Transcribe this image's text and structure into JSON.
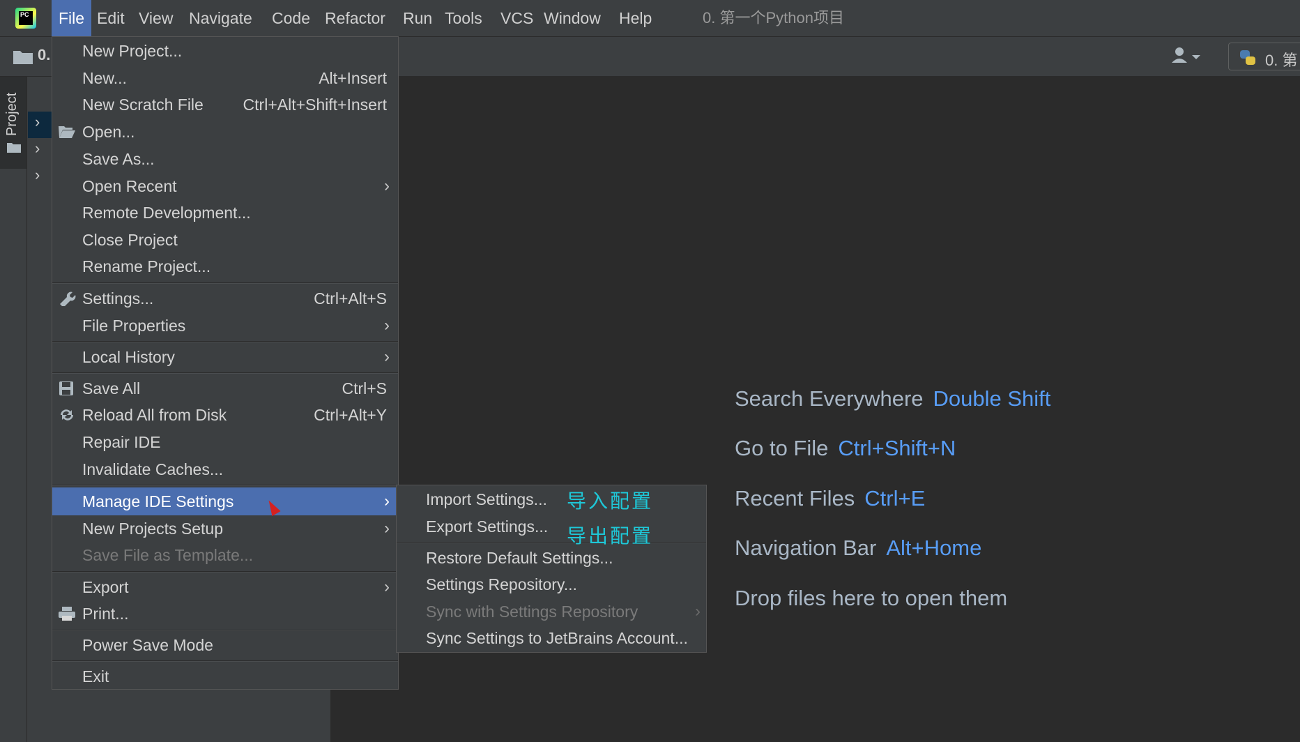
{
  "menubar": {
    "items": [
      "File",
      "Edit",
      "View",
      "Navigate",
      "Code",
      "Refactor",
      "Run",
      "Tools",
      "VCS",
      "Window",
      "Help"
    ],
    "active": "File",
    "window_title": "0. 第一个Python项目"
  },
  "toolbar": {
    "project_crumb": "0.",
    "run_config_label": "0. 第"
  },
  "sidebar": {
    "project_tab_label": "Project"
  },
  "file_menu": {
    "items": [
      {
        "label": "New Project...",
        "shortcut": ""
      },
      {
        "label": "New...",
        "shortcut": "Alt+Insert"
      },
      {
        "label": "New Scratch File",
        "shortcut": "Ctrl+Alt+Shift+Insert"
      },
      {
        "label": "Open...",
        "shortcut": "",
        "icon": "folder-open-icon"
      },
      {
        "label": "Save As...",
        "shortcut": ""
      },
      {
        "label": "Open Recent",
        "shortcut": "",
        "submenu": true
      },
      {
        "label": "Remote Development...",
        "shortcut": ""
      },
      {
        "label": "Close Project",
        "shortcut": ""
      },
      {
        "label": "Rename Project...",
        "shortcut": ""
      },
      {
        "label": "Settings...",
        "shortcut": "Ctrl+Alt+S",
        "icon": "wrench-icon"
      },
      {
        "label": "File Properties",
        "shortcut": "",
        "submenu": true
      },
      {
        "label": "Local History",
        "shortcut": "",
        "submenu": true
      },
      {
        "label": "Save All",
        "shortcut": "Ctrl+S",
        "icon": "save-icon"
      },
      {
        "label": "Reload All from Disk",
        "shortcut": "Ctrl+Alt+Y",
        "icon": "reload-icon"
      },
      {
        "label": "Repair IDE",
        "shortcut": ""
      },
      {
        "label": "Invalidate Caches...",
        "shortcut": ""
      },
      {
        "label": "Manage IDE Settings",
        "shortcut": "",
        "submenu": true,
        "selected": true
      },
      {
        "label": "New Projects Setup",
        "shortcut": "",
        "submenu": true
      },
      {
        "label": "Save File as Template...",
        "shortcut": "",
        "disabled": true
      },
      {
        "label": "Export",
        "shortcut": "",
        "submenu": true
      },
      {
        "label": "Print...",
        "shortcut": "",
        "icon": "printer-icon"
      },
      {
        "label": "Power Save Mode",
        "shortcut": ""
      },
      {
        "label": "Exit",
        "shortcut": ""
      }
    ]
  },
  "manage_settings_submenu": {
    "items": [
      {
        "label": "Import Settings..."
      },
      {
        "label": "Export Settings..."
      },
      {
        "label": "Restore Default Settings..."
      },
      {
        "label": "Settings Repository..."
      },
      {
        "label": "Sync with Settings Repository",
        "disabled": true,
        "submenu": true
      },
      {
        "label": "Sync Settings to JetBrains Account..."
      }
    ],
    "annotations": {
      "import": "导入配置",
      "export": "导出配置"
    }
  },
  "welcome_hints": [
    {
      "text": "Search Everywhere",
      "key": "Double Shift"
    },
    {
      "text": "Go to File",
      "key": "Ctrl+Shift+N"
    },
    {
      "text": "Recent Files",
      "key": "Ctrl+E"
    },
    {
      "text": "Navigation Bar",
      "key": "Alt+Home"
    },
    {
      "text": "Drop files here to open them",
      "key": ""
    }
  ],
  "colors": {
    "background": "#2b2b2b",
    "panel": "#3c3f41",
    "selection": "#4b6eaf",
    "shortcut_key": "#589df6",
    "annotation": "#1ec8d8"
  }
}
